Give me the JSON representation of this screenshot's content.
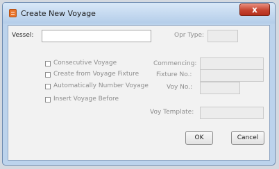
{
  "window": {
    "title": "Create New Voyage",
    "close_glyph": "x"
  },
  "fields": {
    "vessel": {
      "label": "Vessel:",
      "value": ""
    },
    "opr_type": {
      "label": "Opr Type:",
      "value": ""
    },
    "commencing": {
      "label": "Commencing:",
      "value": ""
    },
    "fixture_no": {
      "label": "Fixture No.:",
      "value": ""
    },
    "voy_no": {
      "label": "Voy No.:",
      "value": ""
    },
    "voy_template": {
      "label": "Voy Template:",
      "value": ""
    }
  },
  "checkboxes": {
    "consecutive_voyage": {
      "label": "Consecutive Voyage",
      "checked": false
    },
    "create_from_fixture": {
      "label": "Create from Voyage Fixture",
      "checked": false
    },
    "auto_number": {
      "label": "Automatically Number Voyage",
      "checked": false
    },
    "insert_before": {
      "label": "Insert Voyage Before",
      "checked": false
    }
  },
  "buttons": {
    "ok": "OK",
    "cancel": "Cancel"
  },
  "colors": {
    "close_button": "#c5432f",
    "titlebar": "#b4cde9",
    "app_icon": "#e9742b"
  },
  "icons": {
    "app": "voyage-app-icon",
    "close": "close-icon"
  }
}
